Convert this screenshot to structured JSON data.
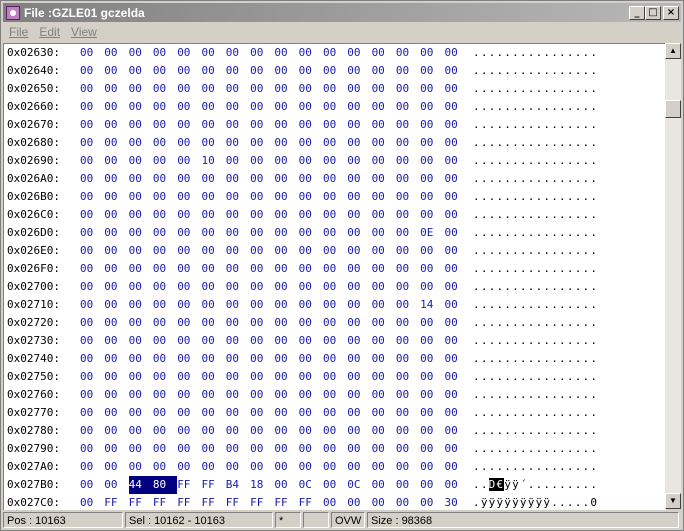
{
  "window": {
    "title": "File :GZLE01 gczelda",
    "buttons": {
      "minimize": "_",
      "maximize": "□",
      "close": "×"
    }
  },
  "menu": [
    {
      "label": "File"
    },
    {
      "label": "Edit"
    },
    {
      "label": "View"
    }
  ],
  "hex_view": {
    "rows": [
      {
        "addr": "0x02630:",
        "bytes": [
          "00",
          "00",
          "00",
          "00",
          "00",
          "00",
          "00",
          "00",
          "00",
          "00",
          "00",
          "00",
          "00",
          "00",
          "00",
          "00"
        ],
        "ascii": "................",
        "sel_bytes": [],
        "ascii_sel": ""
      },
      {
        "addr": "0x02640:",
        "bytes": [
          "00",
          "00",
          "00",
          "00",
          "00",
          "00",
          "00",
          "00",
          "00",
          "00",
          "00",
          "00",
          "00",
          "00",
          "00",
          "00"
        ],
        "ascii": "................",
        "sel_bytes": [],
        "ascii_sel": ""
      },
      {
        "addr": "0x02650:",
        "bytes": [
          "00",
          "00",
          "00",
          "00",
          "00",
          "00",
          "00",
          "00",
          "00",
          "00",
          "00",
          "00",
          "00",
          "00",
          "00",
          "00"
        ],
        "ascii": "................",
        "sel_bytes": [],
        "ascii_sel": ""
      },
      {
        "addr": "0x02660:",
        "bytes": [
          "00",
          "00",
          "00",
          "00",
          "00",
          "00",
          "00",
          "00",
          "00",
          "00",
          "00",
          "00",
          "00",
          "00",
          "00",
          "00"
        ],
        "ascii": "................",
        "sel_bytes": [],
        "ascii_sel": ""
      },
      {
        "addr": "0x02670:",
        "bytes": [
          "00",
          "00",
          "00",
          "00",
          "00",
          "00",
          "00",
          "00",
          "00",
          "00",
          "00",
          "00",
          "00",
          "00",
          "00",
          "00"
        ],
        "ascii": "................",
        "sel_bytes": [],
        "ascii_sel": ""
      },
      {
        "addr": "0x02680:",
        "bytes": [
          "00",
          "00",
          "00",
          "00",
          "00",
          "00",
          "00",
          "00",
          "00",
          "00",
          "00",
          "00",
          "00",
          "00",
          "00",
          "00"
        ],
        "ascii": "................",
        "sel_bytes": [],
        "ascii_sel": ""
      },
      {
        "addr": "0x02690:",
        "bytes": [
          "00",
          "00",
          "00",
          "00",
          "00",
          "10",
          "00",
          "00",
          "00",
          "00",
          "00",
          "00",
          "00",
          "00",
          "00",
          "00"
        ],
        "ascii": "................",
        "sel_bytes": [],
        "ascii_sel": ""
      },
      {
        "addr": "0x026A0:",
        "bytes": [
          "00",
          "00",
          "00",
          "00",
          "00",
          "00",
          "00",
          "00",
          "00",
          "00",
          "00",
          "00",
          "00",
          "00",
          "00",
          "00"
        ],
        "ascii": "................",
        "sel_bytes": [],
        "ascii_sel": ""
      },
      {
        "addr": "0x026B0:",
        "bytes": [
          "00",
          "00",
          "00",
          "00",
          "00",
          "00",
          "00",
          "00",
          "00",
          "00",
          "00",
          "00",
          "00",
          "00",
          "00",
          "00"
        ],
        "ascii": "................",
        "sel_bytes": [],
        "ascii_sel": ""
      },
      {
        "addr": "0x026C0:",
        "bytes": [
          "00",
          "00",
          "00",
          "00",
          "00",
          "00",
          "00",
          "00",
          "00",
          "00",
          "00",
          "00",
          "00",
          "00",
          "00",
          "00"
        ],
        "ascii": "................",
        "sel_bytes": [],
        "ascii_sel": ""
      },
      {
        "addr": "0x026D0:",
        "bytes": [
          "00",
          "00",
          "00",
          "00",
          "00",
          "00",
          "00",
          "00",
          "00",
          "00",
          "00",
          "00",
          "00",
          "00",
          "0E",
          "00"
        ],
        "ascii": "................",
        "sel_bytes": [],
        "ascii_sel": ""
      },
      {
        "addr": "0x026E0:",
        "bytes": [
          "00",
          "00",
          "00",
          "00",
          "00",
          "00",
          "00",
          "00",
          "00",
          "00",
          "00",
          "00",
          "00",
          "00",
          "00",
          "00"
        ],
        "ascii": "................",
        "sel_bytes": [],
        "ascii_sel": ""
      },
      {
        "addr": "0x026F0:",
        "bytes": [
          "00",
          "00",
          "00",
          "00",
          "00",
          "00",
          "00",
          "00",
          "00",
          "00",
          "00",
          "00",
          "00",
          "00",
          "00",
          "00"
        ],
        "ascii": "................",
        "sel_bytes": [],
        "ascii_sel": ""
      },
      {
        "addr": "0x02700:",
        "bytes": [
          "00",
          "00",
          "00",
          "00",
          "00",
          "00",
          "00",
          "00",
          "00",
          "00",
          "00",
          "00",
          "00",
          "00",
          "00",
          "00"
        ],
        "ascii": "................",
        "sel_bytes": [],
        "ascii_sel": ""
      },
      {
        "addr": "0x02710:",
        "bytes": [
          "00",
          "00",
          "00",
          "00",
          "00",
          "00",
          "00",
          "00",
          "00",
          "00",
          "00",
          "00",
          "00",
          "00",
          "14",
          "00"
        ],
        "ascii": "................",
        "sel_bytes": [],
        "ascii_sel": ""
      },
      {
        "addr": "0x02720:",
        "bytes": [
          "00",
          "00",
          "00",
          "00",
          "00",
          "00",
          "00",
          "00",
          "00",
          "00",
          "00",
          "00",
          "00",
          "00",
          "00",
          "00"
        ],
        "ascii": "................",
        "sel_bytes": [],
        "ascii_sel": ""
      },
      {
        "addr": "0x02730:",
        "bytes": [
          "00",
          "00",
          "00",
          "00",
          "00",
          "00",
          "00",
          "00",
          "00",
          "00",
          "00",
          "00",
          "00",
          "00",
          "00",
          "00"
        ],
        "ascii": "................",
        "sel_bytes": [],
        "ascii_sel": ""
      },
      {
        "addr": "0x02740:",
        "bytes": [
          "00",
          "00",
          "00",
          "00",
          "00",
          "00",
          "00",
          "00",
          "00",
          "00",
          "00",
          "00",
          "00",
          "00",
          "00",
          "00"
        ],
        "ascii": "................",
        "sel_bytes": [],
        "ascii_sel": ""
      },
      {
        "addr": "0x02750:",
        "bytes": [
          "00",
          "00",
          "00",
          "00",
          "00",
          "00",
          "00",
          "00",
          "00",
          "00",
          "00",
          "00",
          "00",
          "00",
          "00",
          "00"
        ],
        "ascii": "................",
        "sel_bytes": [],
        "ascii_sel": ""
      },
      {
        "addr": "0x02760:",
        "bytes": [
          "00",
          "00",
          "00",
          "00",
          "00",
          "00",
          "00",
          "00",
          "00",
          "00",
          "00",
          "00",
          "00",
          "00",
          "00",
          "00"
        ],
        "ascii": "................",
        "sel_bytes": [],
        "ascii_sel": ""
      },
      {
        "addr": "0x02770:",
        "bytes": [
          "00",
          "00",
          "00",
          "00",
          "00",
          "00",
          "00",
          "00",
          "00",
          "00",
          "00",
          "00",
          "00",
          "00",
          "00",
          "00"
        ],
        "ascii": "................",
        "sel_bytes": [],
        "ascii_sel": ""
      },
      {
        "addr": "0x02780:",
        "bytes": [
          "00",
          "00",
          "00",
          "00",
          "00",
          "00",
          "00",
          "00",
          "00",
          "00",
          "00",
          "00",
          "00",
          "00",
          "00",
          "00"
        ],
        "ascii": "................",
        "sel_bytes": [],
        "ascii_sel": ""
      },
      {
        "addr": "0x02790:",
        "bytes": [
          "00",
          "00",
          "00",
          "00",
          "00",
          "00",
          "00",
          "00",
          "00",
          "00",
          "00",
          "00",
          "00",
          "00",
          "00",
          "00"
        ],
        "ascii": "................",
        "sel_bytes": [],
        "ascii_sel": ""
      },
      {
        "addr": "0x027A0:",
        "bytes": [
          "00",
          "00",
          "00",
          "00",
          "00",
          "00",
          "00",
          "00",
          "00",
          "00",
          "00",
          "00",
          "00",
          "00",
          "00",
          "00"
        ],
        "ascii": "................",
        "sel_bytes": [],
        "ascii_sel": ""
      },
      {
        "addr": "0x027B0:",
        "bytes": [
          "00",
          "00",
          "44",
          "80",
          "FF",
          "FF",
          "B4",
          "18",
          "00",
          "0C",
          "00",
          "0C",
          "00",
          "00",
          "00",
          "00"
        ],
        "ascii_pre": "..",
        "ascii_sel": "D€",
        "ascii_post": "ÿÿ´.........",
        "sel_bytes": [
          2,
          3
        ]
      },
      {
        "addr": "0x027C0:",
        "bytes": [
          "00",
          "FF",
          "FF",
          "FF",
          "FF",
          "FF",
          "FF",
          "FF",
          "FF",
          "FF",
          "00",
          "00",
          "00",
          "00",
          "00",
          "30"
        ],
        "ascii": ".ÿÿÿÿÿÿÿÿÿ.....0",
        "sel_bytes": [],
        "ascii_sel": ""
      }
    ]
  },
  "status": {
    "pos": "Pos : 10163",
    "sel": "Sel : 10162 - 10163",
    "mark": "*",
    "blank": "",
    "ovw": "OVW",
    "size": "Size : 98368"
  },
  "scrollbar": {
    "up": "▲",
    "down": "▼",
    "position": 0.1
  }
}
